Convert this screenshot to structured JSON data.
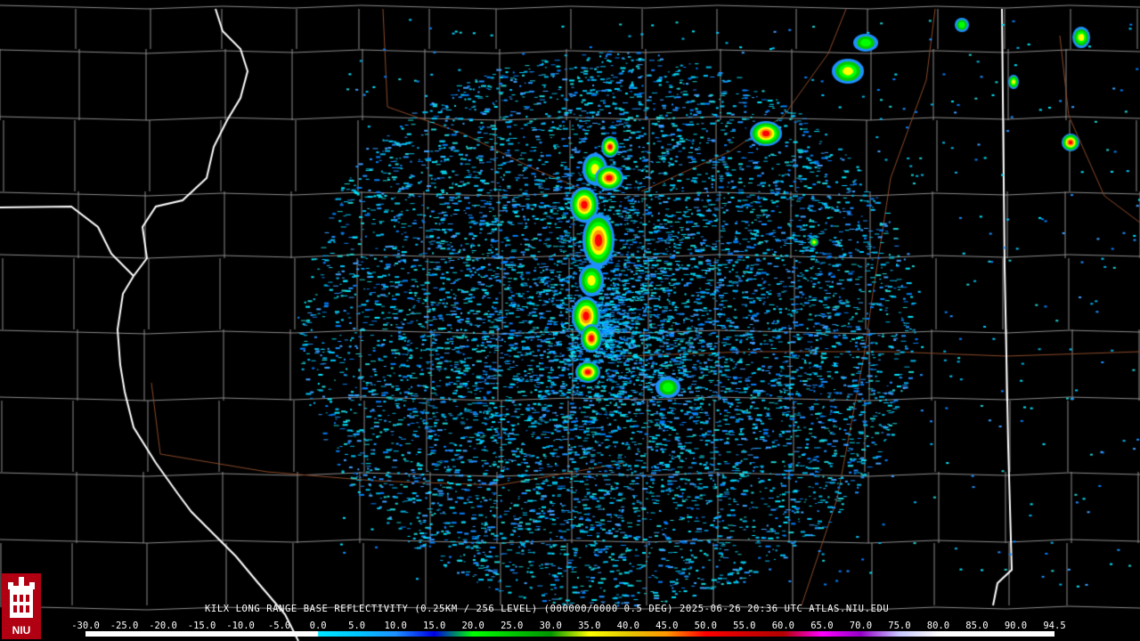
{
  "caption": "KILX LONG RANGE BASE REFLECTIVITY (0.25KM / 256 LEVEL) (000000/0000 0.5 DEG) 2025-06-26 20:36 UTC  ATLAS.NIU.EDU",
  "logo": {
    "text": "NIU",
    "icon": "niu-castle-logo-icon"
  },
  "scale": {
    "labels": [
      "-30.0",
      "-25.0",
      "-20.0",
      "-15.0",
      "-10.0",
      "-5.0",
      "0.0",
      "5.0",
      "10.0",
      "15.0",
      "20.0",
      "25.0",
      "30.0",
      "35.0",
      "40.0",
      "45.0",
      "50.0",
      "55.0",
      "60.0",
      "65.0",
      "70.0",
      "75.0",
      "80.0",
      "85.0",
      "90.0",
      "94.5"
    ],
    "values": [
      -30,
      -25,
      -20,
      -15,
      -10,
      -5,
      0,
      5,
      10,
      15,
      20,
      25,
      30,
      35,
      40,
      45,
      50,
      55,
      60,
      65,
      70,
      75,
      80,
      85,
      90,
      94.5
    ],
    "colors": [
      "#ffffff",
      "#ffffff",
      "#ffffff",
      "#ffffff",
      "#ffffff",
      "#ffffff",
      "#00e6ff",
      "#00c8ff",
      "#1e90ff",
      "#0000e6",
      "#00ff00",
      "#00c800",
      "#009600",
      "#ffff00",
      "#e6c800",
      "#ff9600",
      "#ff0000",
      "#d20000",
      "#b40000",
      "#ff00ff",
      "#9600c8",
      "#c8c8ff",
      "#ffffff",
      "#ffffff",
      "#ffffff",
      "#ffffff"
    ]
  },
  "colors": {
    "background": "#000000",
    "county_lines": "#8c8c8c",
    "state_lines": "#ffffff",
    "highways": "#8b4a2a"
  }
}
